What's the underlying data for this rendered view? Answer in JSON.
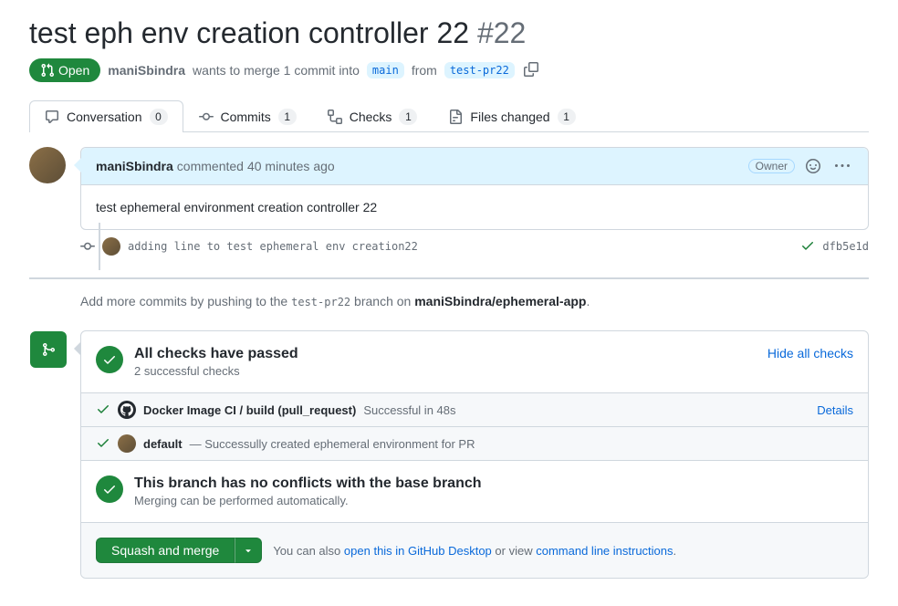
{
  "pr": {
    "title": "test eph env creation controller 22",
    "number": "#22",
    "state": "Open",
    "author": "maniSbindra",
    "merge_text_1": "wants to merge 1 commit into",
    "base_branch": "main",
    "merge_text_2": "from",
    "head_branch": "test-pr22"
  },
  "tabs": {
    "conversation": {
      "label": "Conversation",
      "count": "0"
    },
    "commits": {
      "label": "Commits",
      "count": "1"
    },
    "checks": {
      "label": "Checks",
      "count": "1"
    },
    "files": {
      "label": "Files changed",
      "count": "1"
    }
  },
  "comment": {
    "author": "maniSbindra",
    "action": "commented",
    "time": "40 minutes ago",
    "owner_label": "Owner",
    "body": "test ephemeral environment creation controller 22"
  },
  "commit": {
    "message": "adding line to test ephemeral env creation22",
    "sha": "dfb5e1d"
  },
  "push_hint": {
    "prefix": "Add more commits by pushing to the",
    "branch": "test-pr22",
    "mid": "branch on",
    "repo": "maniSbindra/ephemeral-app"
  },
  "checks": {
    "title": "All checks have passed",
    "subtitle": "2 successful checks",
    "toggle": "Hide all checks",
    "items": [
      {
        "name": "Docker Image CI / build (pull_request)",
        "status": "Successful in 48s",
        "details": "Details",
        "icon": "github"
      },
      {
        "name": "default",
        "status": "— Successully created ephemeral environment for PR",
        "details": "",
        "icon": "avatar"
      }
    ]
  },
  "conflicts": {
    "title": "This branch has no conflicts with the base branch",
    "subtitle": "Merging can be performed automatically."
  },
  "merge": {
    "button": "Squash and merge",
    "help_prefix": "You can also",
    "help_link1": "open this in GitHub Desktop",
    "help_mid": "or view",
    "help_link2": "command line instructions"
  }
}
